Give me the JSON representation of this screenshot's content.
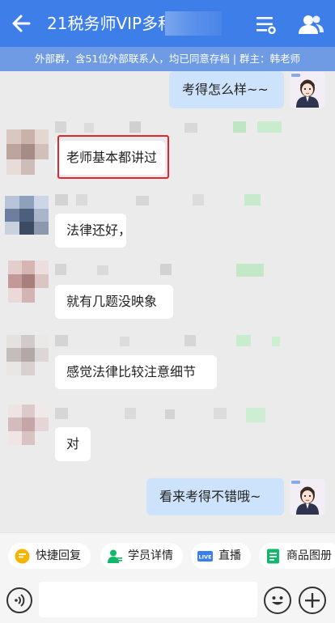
{
  "header": {
    "title": "21税务师VIP多科",
    "bg_color": "#3d7ee8",
    "icons": {
      "back": "arrow-left-icon",
      "settings": "settings-sliders-icon",
      "members": "members-icon"
    }
  },
  "notice": {
    "text": "外部群，含51位外部联系人，均已同意存档 | 群主：韩老师"
  },
  "messages": [
    {
      "side": "out",
      "text": "考得怎么样~~"
    },
    {
      "side": "in",
      "text": "老师基本都讲过",
      "highlighted": true
    },
    {
      "side": "in",
      "text": "法律还好，"
    },
    {
      "side": "in",
      "text": "就有几题没映象"
    },
    {
      "side": "in",
      "text": "感觉法律比较注意细节"
    },
    {
      "side": "in",
      "text": "对"
    },
    {
      "side": "out",
      "text": "看来考得不错哦~"
    }
  ],
  "colors": {
    "highlight": "#e1262d",
    "out_bubble": "#cde3fb",
    "in_bubble": "#ffffff"
  },
  "quick_actions": [
    {
      "label": "快捷回复",
      "icon": "quick-reply-icon",
      "color": "#f5b400"
    },
    {
      "label": "学员详情",
      "icon": "student-icon",
      "color": "#12b76a"
    },
    {
      "label": "直播",
      "icon": "live-icon",
      "color": "#3d7ee8"
    },
    {
      "label": "商品图册",
      "icon": "catalog-icon",
      "color": "#12b76a"
    }
  ],
  "input": {
    "placeholder": ""
  }
}
